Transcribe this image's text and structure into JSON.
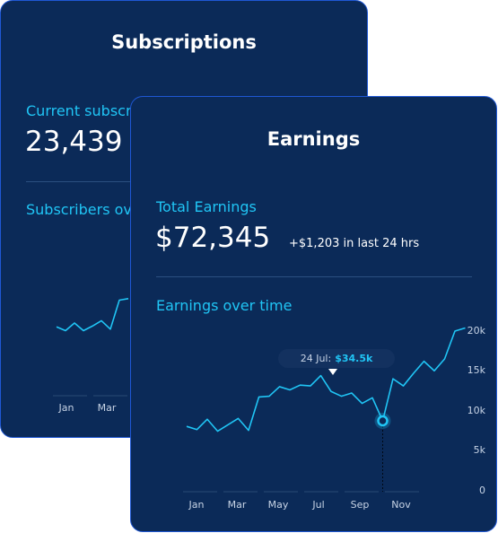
{
  "subscriptions_card": {
    "title": "Subscriptions",
    "current_label": "Current subscri",
    "current_value": "23,439",
    "chart_label": "Subscribers ov",
    "months": [
      "Jan",
      "Mar"
    ]
  },
  "earnings_card": {
    "title": "Earnings",
    "total_label": "Total Earnings",
    "total_value": "$72,345",
    "delta_text": "+$1,203 in last 24 hrs",
    "chart_label": "Earnings over time",
    "tooltip_date": "24 Jul:",
    "tooltip_value": "$34.5k",
    "y_ticks": [
      "20k",
      "15k",
      "10k",
      "5k",
      "0"
    ],
    "months": [
      "Jan",
      "Mar",
      "May",
      "Jul",
      "Sep",
      "Nov"
    ]
  },
  "colors": {
    "card_bg": "#0b2a58",
    "card_border": "#1f57d4",
    "accent": "#20c5f5",
    "text": "#ffffff"
  },
  "chart_data": [
    {
      "type": "line",
      "series": [
        {
          "values": [
            5.5,
            5.0,
            6.0,
            5.0,
            5.6,
            6.3,
            5.2,
            9.0,
            9.2
          ]
        }
      ],
      "categories": [
        "Jan",
        "Mar"
      ]
    },
    {
      "type": "line",
      "categories": [
        "Jan",
        "Mar",
        "May",
        "Jul",
        "Sep",
        "Nov"
      ],
      "x": [
        0,
        1,
        2,
        3,
        4,
        5,
        6,
        7,
        8,
        9,
        10,
        11,
        12,
        13,
        14,
        15,
        16,
        17,
        18,
        19,
        20,
        21,
        22,
        23,
        24,
        25,
        26,
        27
      ],
      "series": [
        {
          "values": [
            8.0,
            7.6,
            8.9,
            7.4,
            8.2,
            9.0,
            7.5,
            11.7,
            11.8,
            13.0,
            12.6,
            13.2,
            13.1,
            14.4,
            12.4,
            11.8,
            12.2,
            10.9,
            11.6,
            8.7,
            14.0,
            13.1,
            14.7,
            16.2,
            15.0,
            16.5,
            20.0,
            20.4
          ]
        }
      ],
      "ylim": [
        0,
        20
      ],
      "highlight": {
        "label": "24 Jul",
        "value": 34.5,
        "unit": "k"
      }
    }
  ]
}
